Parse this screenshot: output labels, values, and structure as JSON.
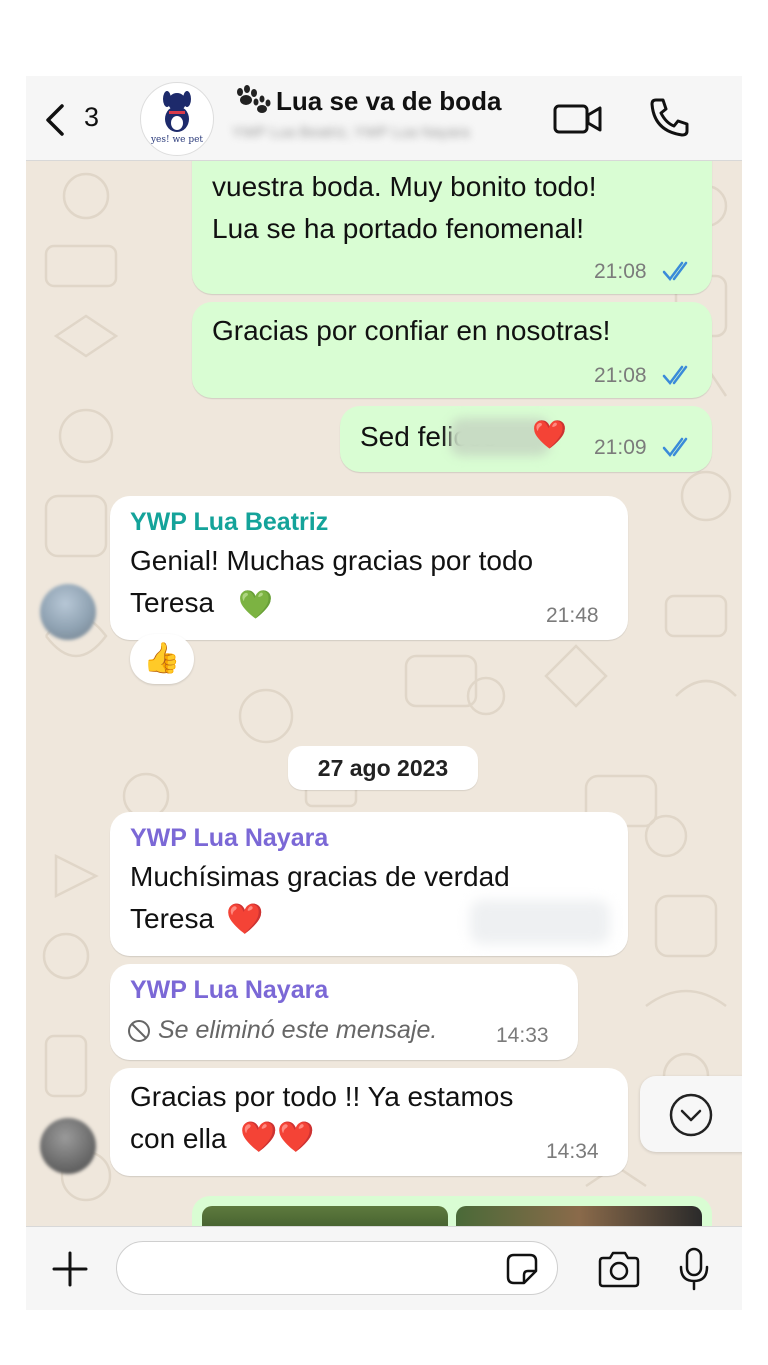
{
  "header": {
    "back_count": "3",
    "title": "Lua se va de boda",
    "subtitle": "YWP Lua Beatriz, YWP Lua Nayara",
    "logo_text": "yes! we pet"
  },
  "messages": [
    {
      "line1": "vuestra boda. Muy bonito todo!",
      "line2": "Lua se ha portado fenomenal!",
      "time": "21:08"
    },
    {
      "line1": "Gracias por confiar en nosotras!",
      "time": "21:08"
    },
    {
      "line1": "Sed felices",
      "emoji": "❤️",
      "time": "21:09"
    },
    {
      "sender": "YWP Lua Beatriz",
      "line1": "Genial! Muchas gracias por todo",
      "line2": "Teresa",
      "emoji": "💚",
      "time": "21:48",
      "reaction": "👍"
    },
    {
      "sender": "YWP Lua Nayara",
      "line1": "Muchísimas gracias de verdad",
      "line2": "Teresa",
      "emoji": "❤️"
    },
    {
      "sender": "YWP Lua Nayara",
      "deleted": "Se eliminó este mensaje.",
      "time": "14:33"
    },
    {
      "line1": "Gracias por todo !! Ya estamos",
      "line2": "con ella",
      "emoji": "❤️❤️",
      "time": "14:34"
    }
  ],
  "date_separator": "27 ago 2023",
  "footer": {
    "input_placeholder": ""
  },
  "colors": {
    "beatriz": "#14a39a",
    "nayara": "#7b68d6",
    "outgoing_bubble": "#d9fdd3",
    "read_ticks": "#3a8bd9"
  },
  "icons": [
    "chevron-left-icon",
    "paw-icon",
    "video-icon",
    "phone-icon",
    "check-double-icon",
    "thumbs-up-icon",
    "prohibited-icon",
    "chevron-down-icon",
    "plus-icon",
    "sticker-icon",
    "camera-icon",
    "microphone-icon"
  ]
}
